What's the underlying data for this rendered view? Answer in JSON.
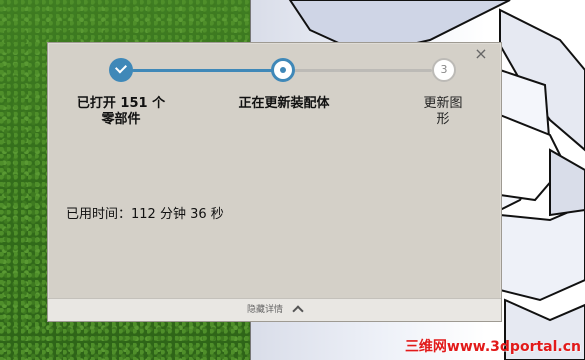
{
  "dialog": {
    "close_label": "×",
    "steps": [
      {
        "label": "已打开 151 个零部件",
        "state": "done"
      },
      {
        "label": "正在更新装配体",
        "state": "active"
      },
      {
        "number": "3",
        "label": "更新图形",
        "state": "pending"
      }
    ],
    "elapsed_text": "已用时间：112 分钟 36 秒",
    "footer": {
      "hide_details_label": "隐藏详情"
    }
  },
  "watermark": "三维网www.3dportal.cn",
  "colors": {
    "accent": "#3f88b8",
    "dialog_bg": "#d4d0c8",
    "watermark": "#e21a1a"
  },
  "icons": {
    "close": "close-icon",
    "done_step": "check-icon",
    "active_step": "dot-icon",
    "footer": "chevron-up-icon"
  }
}
